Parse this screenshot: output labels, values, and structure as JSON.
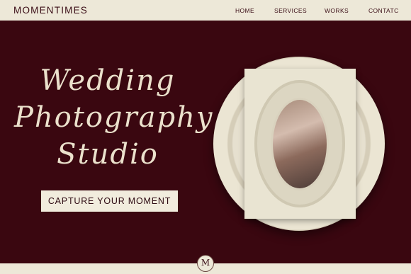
{
  "header": {
    "brand": "MOMENTIMES",
    "nav": [
      "HOME",
      "SERVICES",
      "WORKS",
      "CONTATC"
    ]
  },
  "hero": {
    "headline": [
      "Wedding",
      "Photography",
      "Studio"
    ],
    "cta_label": "CAPTURE YOUR MOMENT"
  },
  "footer": {
    "badge_letter": "M"
  },
  "colors": {
    "primary": "#3a0710",
    "cream": "#ede8d8",
    "text_dark": "#3a0d16"
  }
}
